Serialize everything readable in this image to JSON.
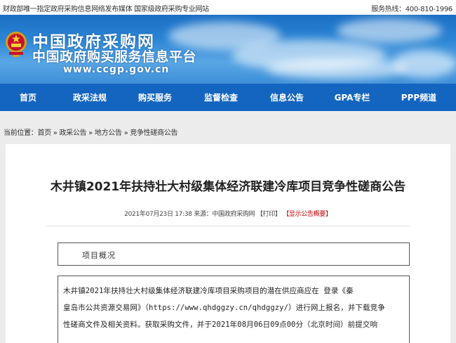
{
  "topbar": {
    "left_text": "财政部唯一指定政府采购信息网络发布媒体 国家级政府采购专业网站",
    "hotline": "服务热线：400-810-1996"
  },
  "header": {
    "site_name": "中国政府采购网",
    "site_subtitle": "中国政府购买服务信息平台",
    "site_url": "www.ccgp.gov.cn",
    "emblem_icon": "national-emblem-icon"
  },
  "nav": {
    "items": [
      {
        "label": "首页"
      },
      {
        "label": "政采法规"
      },
      {
        "label": "购买服务"
      },
      {
        "label": "监督检查"
      },
      {
        "label": "信息公告"
      },
      {
        "label": "GPA专栏"
      },
      {
        "label": "PPP频道"
      }
    ]
  },
  "breadcrumb": {
    "prefix": "当前位置：",
    "items": [
      "首页",
      "政采公告",
      "地方公告",
      "竞争性磋商公告"
    ],
    "separator": " » "
  },
  "article": {
    "title": "木井镇2021年扶持壮大村级集体经济联建冷库项目竞争性磋商公告",
    "date": "2021年07月23日 17:38",
    "source": "来源：中国政府采购网",
    "print_label": "【打印】",
    "summary_label": "【显示公告概要】",
    "section_title": "项目概况",
    "body_lines": [
      "木井镇2021年扶持壮大村级集体经济联建冷库项目采购项目的潜在供应商应在 登录《秦",
      "皇岛市公共资源交易网》（https://www.qhdggzy.cn/qhdggzy/）进行网上报名，并下载竞争",
      "性磋商文件及相关资料。获取采购文件，并于2021年08月06日09点00分（北京时间）前提交响"
    ]
  },
  "colors": {
    "nav_bg": "#1365bf",
    "summary_red": "#c40000",
    "page_bg": "#ececec"
  }
}
